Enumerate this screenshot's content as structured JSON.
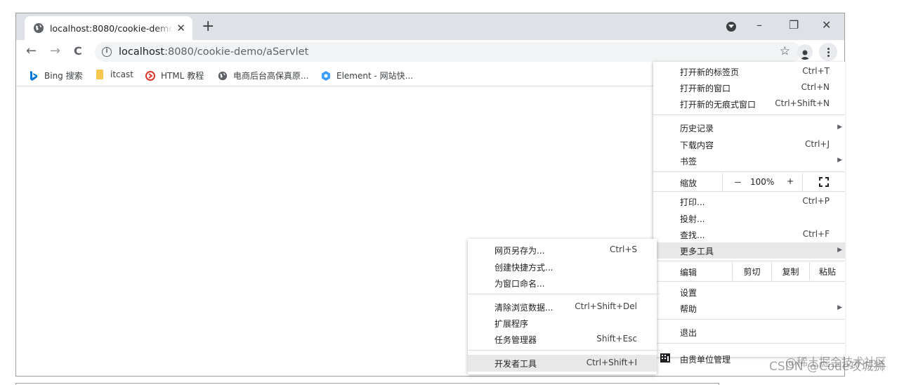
{
  "tab": {
    "title": "localhost:8080/cookie-demo/aServlet",
    "close_glyph": "✕",
    "new_tab_glyph": "+"
  },
  "window_controls": {
    "minimize": "–",
    "restore": "❐",
    "close": "✕"
  },
  "address": {
    "host": "localhost",
    "path": ":8080/cookie-demo/aServlet",
    "star_glyph": "☆"
  },
  "nav": {
    "back": "←",
    "forward": "→",
    "reload": "C"
  },
  "bookmarks": [
    {
      "label": "Bing 搜索",
      "icon": "bing-icon"
    },
    {
      "label": "itcast",
      "icon": "folder-icon"
    },
    {
      "label": "HTML 教程",
      "icon": "runoob-icon"
    },
    {
      "label": "电商后台高保真原...",
      "icon": "globe-icon"
    },
    {
      "label": "Element - 网站快...",
      "icon": "element-icon"
    }
  ],
  "menu": {
    "new_tab": {
      "label": "打开新的标签页",
      "shortcut": "Ctrl+T"
    },
    "new_window": {
      "label": "打开新的窗口",
      "shortcut": "Ctrl+N"
    },
    "incognito": {
      "label": "打开新的无痕式窗口",
      "shortcut": "Ctrl+Shift+N"
    },
    "history": {
      "label": "历史记录"
    },
    "downloads": {
      "label": "下载内容",
      "shortcut": "Ctrl+J"
    },
    "bookmarks": {
      "label": "书签"
    },
    "zoom": {
      "label": "缩放",
      "minus": "－",
      "value": "100%",
      "plus": "+"
    },
    "print": {
      "label": "打印...",
      "shortcut": "Ctrl+P"
    },
    "cast": {
      "label": "投射..."
    },
    "find": {
      "label": "查找...",
      "shortcut": "Ctrl+F"
    },
    "more_tools": {
      "label": "更多工具"
    },
    "edit": {
      "label": "编辑",
      "cut": "剪切",
      "copy": "复制",
      "paste": "粘贴"
    },
    "settings": {
      "label": "设置"
    },
    "help": {
      "label": "帮助"
    },
    "exit": {
      "label": "退出"
    },
    "managed": {
      "label": "由贵单位管理"
    }
  },
  "submenu": {
    "save_page": {
      "label": "网页另存为...",
      "shortcut": "Ctrl+S"
    },
    "create_shortcut": {
      "label": "创建快捷方式..."
    },
    "name_window": {
      "label": "为窗口命名..."
    },
    "clear_data": {
      "label": "清除浏览数据...",
      "shortcut": "Ctrl+Shift+Del"
    },
    "extensions": {
      "label": "扩展程序"
    },
    "task_manager": {
      "label": "任务管理器",
      "shortcut": "Shift+Esc"
    },
    "devtools": {
      "label": "开发者工具",
      "shortcut": "Ctrl+Shift+I"
    }
  },
  "watermark": "CSDN @Code攻城狮",
  "watermark2": "@稀土掘金技术社区"
}
